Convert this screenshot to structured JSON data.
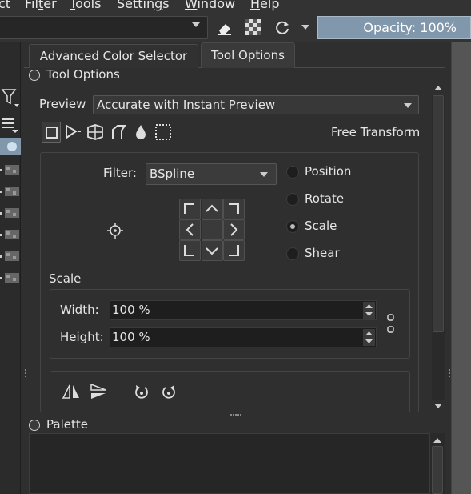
{
  "menu": {
    "items": [
      {
        "label": "ct",
        "mnemonic": ""
      },
      {
        "label": "Filter",
        "mnemonic": "t"
      },
      {
        "label": "Tools",
        "mnemonic": "T"
      },
      {
        "label": "Settings",
        "mnemonic": "g"
      },
      {
        "label": "Window",
        "mnemonic": "W"
      },
      {
        "label": "Help",
        "mnemonic": "H"
      }
    ]
  },
  "toolbar": {
    "opacity_label": "Opacity: 100%"
  },
  "tabs": [
    {
      "label": "Advanced Color Selector",
      "active": false
    },
    {
      "label": "Tool Options",
      "active": true
    }
  ],
  "tool_options": {
    "title": "Tool Options",
    "preview_label": "Preview",
    "preview_value": "Accurate with Instant Preview",
    "mode_name": "Free Transform",
    "modes": [
      "free-transform-icon",
      "perspective-icon",
      "warp-icon",
      "cage-icon",
      "liquify-icon",
      "mesh-icon"
    ],
    "filter_label": "Filter:",
    "filter_value": "BSpline",
    "transform_radios": [
      {
        "label": "Position",
        "checked": false
      },
      {
        "label": "Rotate",
        "checked": false
      },
      {
        "label": "Scale",
        "checked": true
      },
      {
        "label": "Shear",
        "checked": false
      }
    ],
    "scale_title": "Scale",
    "width_label": "Width:",
    "width_value": "100 %",
    "height_label": "Height:",
    "height_value": "100 %"
  },
  "palette": {
    "title": "Palette"
  },
  "colors": {
    "accent": "#8197ab",
    "bg": "#2f2f2f",
    "field": "#1e1e1e"
  }
}
